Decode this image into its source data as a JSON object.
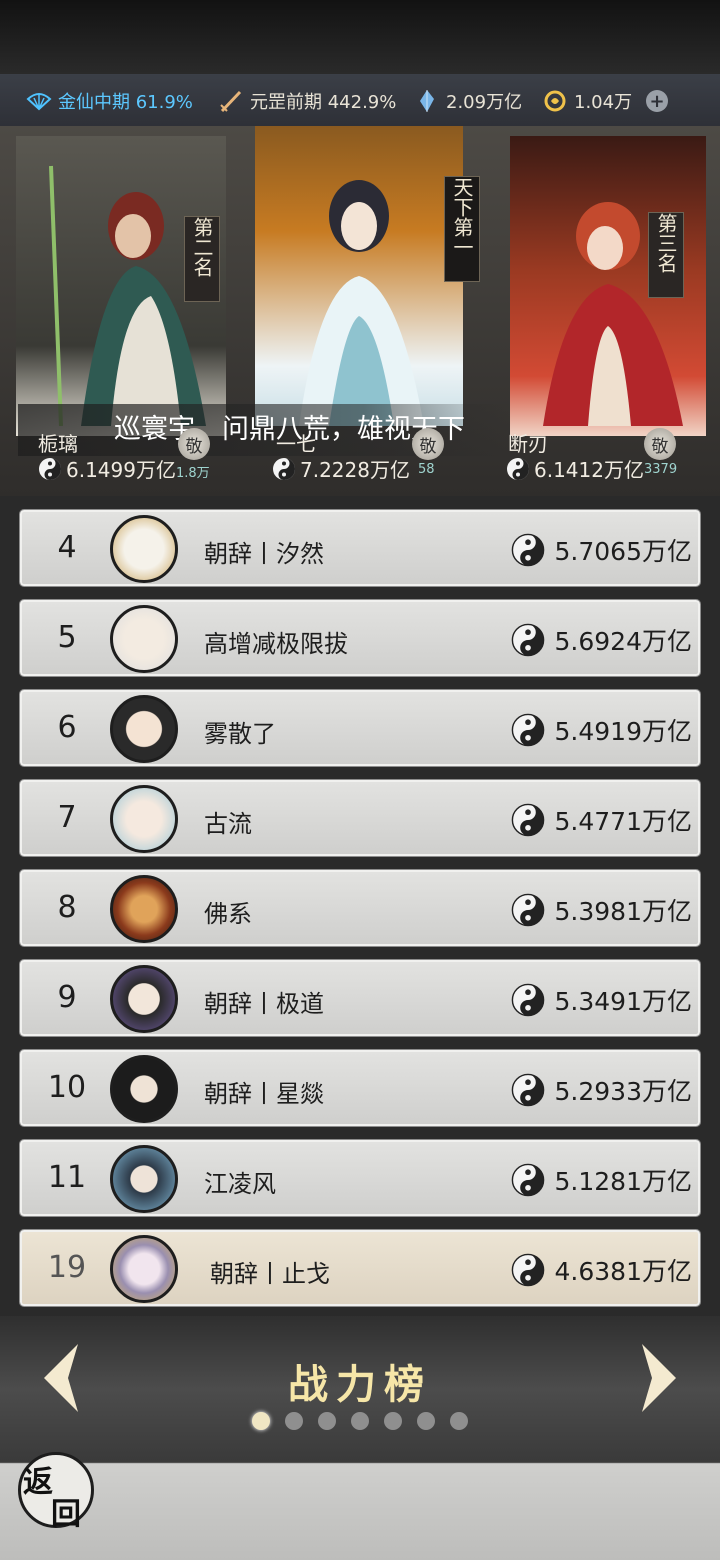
{
  "resources": {
    "realm1": "金仙中期 61.9%",
    "realm2": "元罡前期 442.9%",
    "crystal": "2.09万亿",
    "coin": "1.04万"
  },
  "podium": {
    "slogan": "巡寰宇，问鼎八荒，雄视天下",
    "first": {
      "tag": "天下第一",
      "name": "一七",
      "power": "7.2228万亿",
      "badge": "敬",
      "count": "58"
    },
    "second": {
      "tag": "第二名",
      "name": "栀璃",
      "power": "6.1499万亿",
      "badge": "敬",
      "count": "1.8万"
    },
    "third": {
      "tag": "第三名",
      "name": "断刃",
      "power": "6.1412万亿",
      "badge": "敬",
      "count": "3379"
    }
  },
  "rows": [
    {
      "rank": "4",
      "name": "朝辞丨汐然",
      "power": "5.7065万亿"
    },
    {
      "rank": "5",
      "name": "高增减极限拔",
      "power": "5.6924万亿"
    },
    {
      "rank": "6",
      "name": "雾散了",
      "power": "5.4919万亿"
    },
    {
      "rank": "7",
      "name": "古流",
      "power": "5.4771万亿"
    },
    {
      "rank": "8",
      "name": "佛系",
      "power": "5.3981万亿"
    },
    {
      "rank": "9",
      "name": "朝辞丨极道",
      "power": "5.3491万亿"
    },
    {
      "rank": "10",
      "name": "朝辞丨星燚",
      "power": "5.2933万亿"
    },
    {
      "rank": "11",
      "name": "江凌风",
      "power": "5.1281万亿"
    }
  ],
  "self": {
    "rank": "19",
    "name": "朝辞丨止戈",
    "power": "4.6381万亿"
  },
  "footer": {
    "title": "战力榜",
    "back1": "返",
    "back2": "回",
    "pages": 7,
    "active_page": 1
  }
}
